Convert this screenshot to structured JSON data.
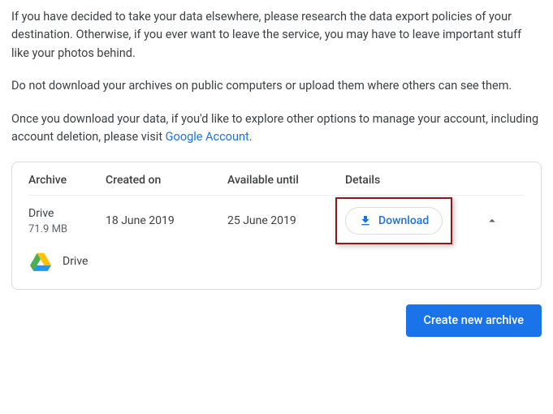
{
  "intro": {
    "p1": "If you have decided to take your data elsewhere, please research the data export policies of your destination. Otherwise, if you ever want to leave the service, you may have to leave important stuff like your photos behind.",
    "p2": "Do not download your archives on public computers or upload them where others can see them.",
    "p3_prefix": "Once you download your data, if you'd like to explore other options to manage your account, including account deletion, please visit ",
    "p3_link": "Google Account",
    "p3_suffix": "."
  },
  "table": {
    "headers": {
      "archive": "Archive",
      "created": "Created on",
      "available": "Available until",
      "details": "Details"
    },
    "row": {
      "name": "Drive",
      "size": "71.9 MB",
      "created": "18 June 2019",
      "available": "25 June 2019",
      "download_label": "Download"
    },
    "service": {
      "name": "Drive"
    }
  },
  "footer": {
    "create_label": "Create new archive"
  },
  "colors": {
    "accent": "#1a73e8",
    "highlight_border": "#8b1a1a"
  }
}
